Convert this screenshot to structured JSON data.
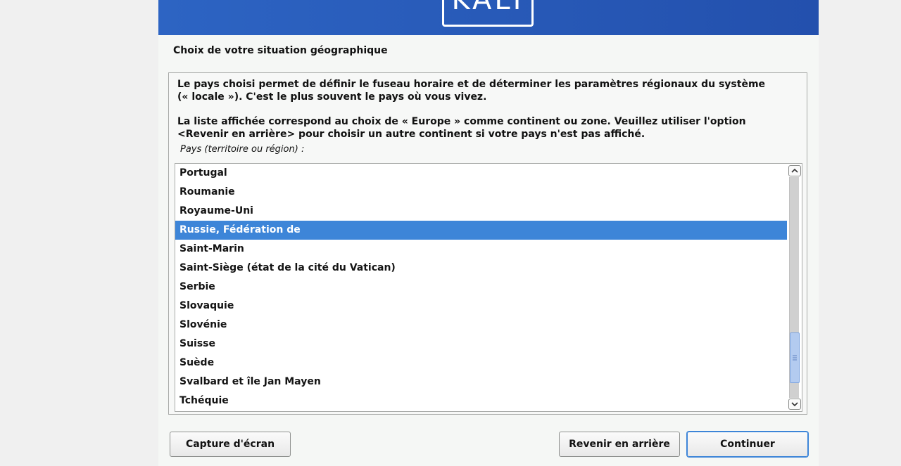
{
  "banner": {
    "logo_text": "KALI"
  },
  "step_title": "Choix de votre situation géographique",
  "description": {
    "paragraph1_line1": "Le pays choisi permet de définir le fuseau horaire et de déterminer les paramètres régionaux du système",
    "paragraph1_line2": "(« locale »). C'est le plus souvent le pays où vous vivez.",
    "paragraph2_line1": "La liste affichée correspond au choix de « Europe » comme continent ou zone. Veuillez utiliser l'option",
    "paragraph2_line2": "<Revenir en arrière> pour choisir un autre continent si votre pays n'est pas affiché."
  },
  "list": {
    "label": "Pays (territoire ou région) :",
    "items": [
      "Portugal",
      "Roumanie",
      "Royaume-Uni",
      "Russie, Fédération de",
      "Saint-Marin",
      "Saint-Siège (état de la cité du Vatican)",
      "Serbie",
      "Slovaquie",
      "Slovénie",
      "Suisse",
      "Suède",
      "Svalbard et île Jan Mayen",
      "Tchéquie"
    ],
    "selected": "Russie, Fédération de"
  },
  "buttons": {
    "screenshot": "Capture d'écran",
    "back": "Revenir en arrière",
    "continue": "Continuer"
  },
  "colors": {
    "banner": "#2d64c3",
    "selection": "#3d85d8",
    "scroll_thumb": "#b3cbf0"
  },
  "icons": {
    "scroll_up": "chevron-up-icon",
    "scroll_down": "chevron-down-icon",
    "scroll_grip": "grip-icon"
  }
}
